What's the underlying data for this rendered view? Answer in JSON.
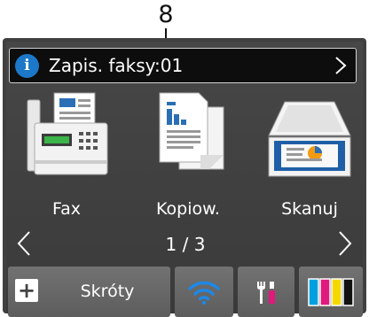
{
  "callout": {
    "number": "8"
  },
  "notification": {
    "text": "Zapis. faksy:01",
    "icon": "info-icon",
    "arrow_icon": "chevron-right-icon"
  },
  "apps": [
    {
      "label": "Fax",
      "icon": "fax-machine-icon"
    },
    {
      "label": "Kopiow.",
      "icon": "copy-documents-icon"
    },
    {
      "label": "Skanuj",
      "icon": "scanner-icon"
    }
  ],
  "pager": {
    "text": "1 / 3",
    "prev_icon": "chevron-left-icon",
    "next_icon": "chevron-right-icon"
  },
  "toolbar": {
    "shortcuts_label": "Skróty",
    "shortcuts_icon": "plus-icon",
    "wifi_icon": "wifi-icon",
    "tools_icon": "tools-icon",
    "ink_icon": "ink-cartridges-icon"
  },
  "colors": {
    "info_blue": "#1c78c8",
    "wifi_blue": "#1e88e5",
    "ink_cyan": "#00a0e0",
    "ink_magenta": "#e0197d",
    "ink_yellow": "#f5d800",
    "ink_black": "#111111"
  }
}
